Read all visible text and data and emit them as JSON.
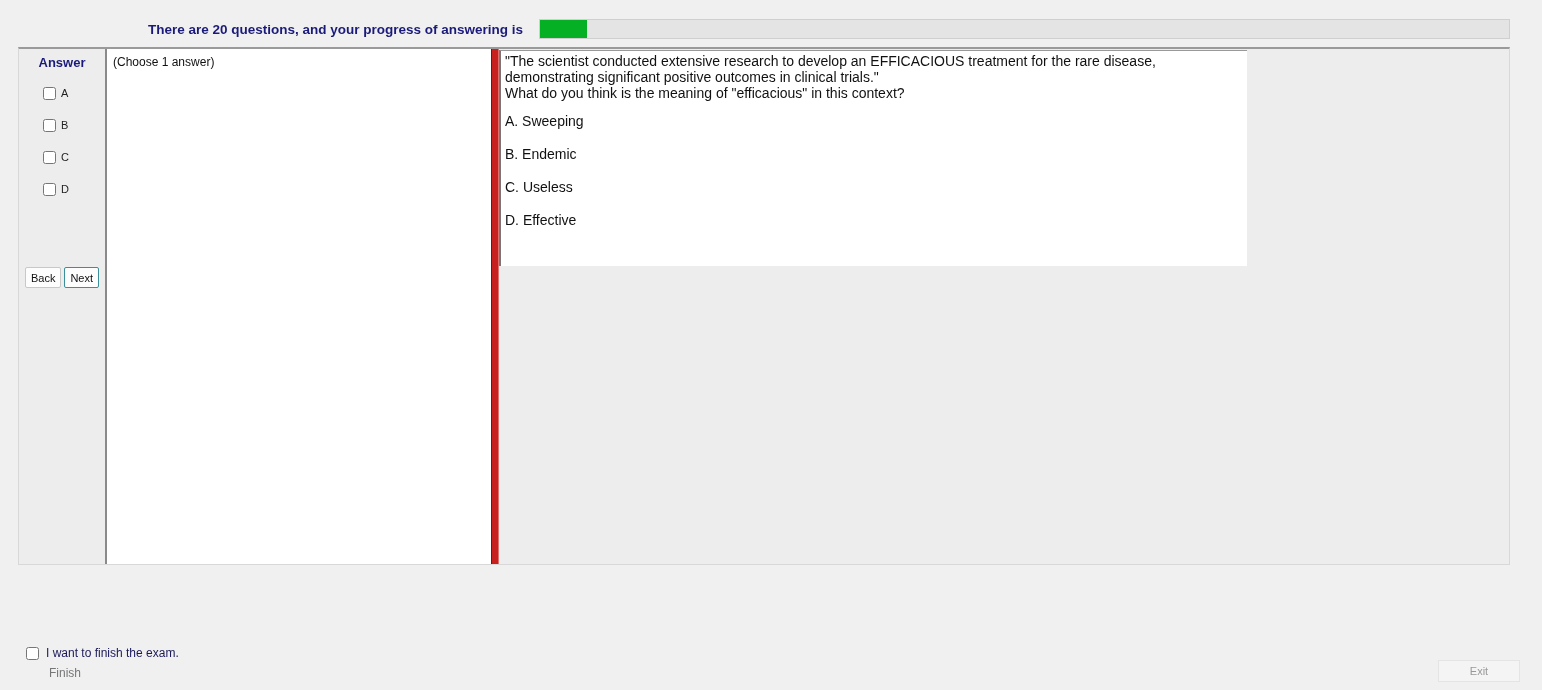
{
  "header": {
    "text": "There are 20 questions, and your progress of answering is",
    "progress": {
      "level": 0.048
    }
  },
  "answer_panel": {
    "title": "Answer",
    "options": [
      {
        "label": "A",
        "checked": false
      },
      {
        "label": "B",
        "checked": false
      },
      {
        "label": "C",
        "checked": false
      },
      {
        "label": "D",
        "checked": false
      }
    ],
    "buttons": [
      {
        "label": "Back",
        "focused": false
      },
      {
        "label": "Next",
        "focused": true
      }
    ]
  },
  "instruction": "(Choose 1 answer)",
  "question": {
    "stem": [
      "\"The scientist conducted extensive research to develop an EFFICACIOUS treatment for the rare disease, demonstrating significant positive outcomes in clinical trials.\"",
      "What do you think is the meaning of \"efficacious\" in this context?"
    ],
    "choices": [
      "A.  Sweeping",
      "B.  Endemic",
      "C.  Useless",
      "D.  Effective"
    ]
  },
  "finish": {
    "label": "I want to finish the exam.",
    "checked": false,
    "button": {
      "label": "Finish",
      "disabled": true
    }
  },
  "exit_button": {
    "label": "Exit",
    "disabled": true
  }
}
